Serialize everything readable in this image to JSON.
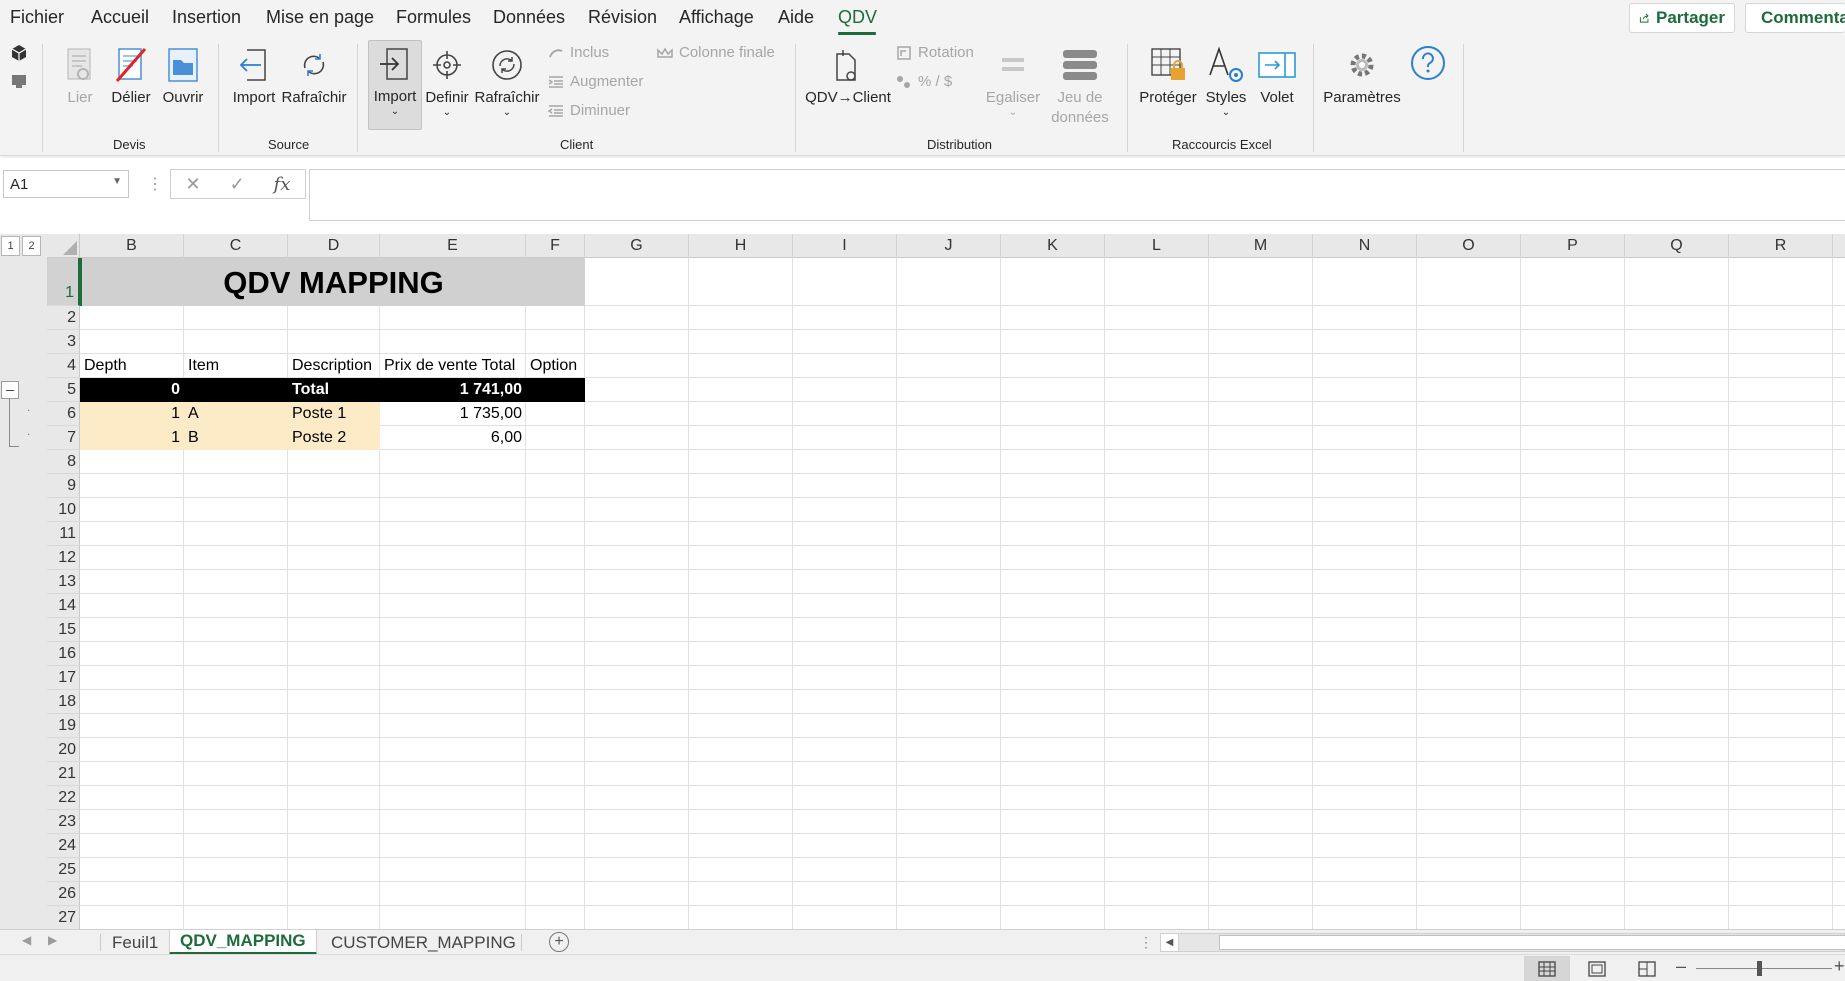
{
  "menu": {
    "items": [
      "Fichier",
      "Accueil",
      "Insertion",
      "Mise en page",
      "Formules",
      "Données",
      "Révision",
      "Affichage",
      "Aide",
      "QDV"
    ],
    "active": "QDV",
    "share_label": "Partager",
    "comments_label": "Commentaires"
  },
  "ribbon": {
    "devis": {
      "lier": "Lier",
      "delier": "Délier",
      "ouvrir": "Ouvrir",
      "group": "Devis"
    },
    "source": {
      "import": "Import",
      "rafraichir": "Rafraîchir",
      "group": "Source"
    },
    "client": {
      "import": "Import",
      "definir": "Definir",
      "rafraichir": "Rafraîchir",
      "inclus": "Inclus",
      "augmenter": "Augmenter",
      "diminuer": "Diminuer",
      "colonne_finale": "Colonne finale",
      "group": "Client"
    },
    "distribution": {
      "qdv_client": "QDV→Client",
      "rotation": "Rotation",
      "percent": "% / $",
      "egaliser": "Egaliser",
      "jeu_line1": "Jeu de",
      "jeu_line2": "données",
      "group": "Distribution"
    },
    "raccourcis": {
      "proteger": "Protéger",
      "styles": "Styles",
      "volet": "Volet",
      "group": "Raccourcis Excel"
    },
    "parametres": "Paramètres",
    "accent_color": "#1e6b3c"
  },
  "formula": {
    "name_box": "A1",
    "value": ""
  },
  "outline_levels": [
    "1",
    "2"
  ],
  "columns": [
    "B",
    "C",
    "D",
    "E",
    "F",
    "G",
    "H",
    "I",
    "J",
    "K",
    "L",
    "M",
    "N",
    "O",
    "P",
    "Q",
    "R"
  ],
  "rows": [
    "1",
    "2",
    "3",
    "4",
    "5",
    "6",
    "7",
    "8",
    "9",
    "10",
    "11",
    "12",
    "13",
    "14",
    "15",
    "16",
    "17",
    "18",
    "19",
    "20",
    "21",
    "22",
    "23",
    "24",
    "25",
    "26",
    "27"
  ],
  "sheet": {
    "title": "QDV MAPPING",
    "headers": {
      "depth": "Depth",
      "item": "Item",
      "description": "Description",
      "prix": "Prix de vente Total",
      "option": "Option"
    },
    "total": {
      "depth": "0",
      "description": "Total",
      "prix": "1 741,00"
    },
    "data": [
      {
        "depth": "1",
        "item": "A",
        "description": "Poste 1",
        "prix": "1 735,00"
      },
      {
        "depth": "1",
        "item": "B",
        "description": "Poste 2",
        "prix": "6,00"
      }
    ],
    "band_color": "#fdebc8"
  },
  "tabs": {
    "sheets": [
      "Feuil1",
      "QDV_MAPPING",
      "CUSTOMER_MAPPING"
    ],
    "active": "QDV_MAPPING"
  }
}
